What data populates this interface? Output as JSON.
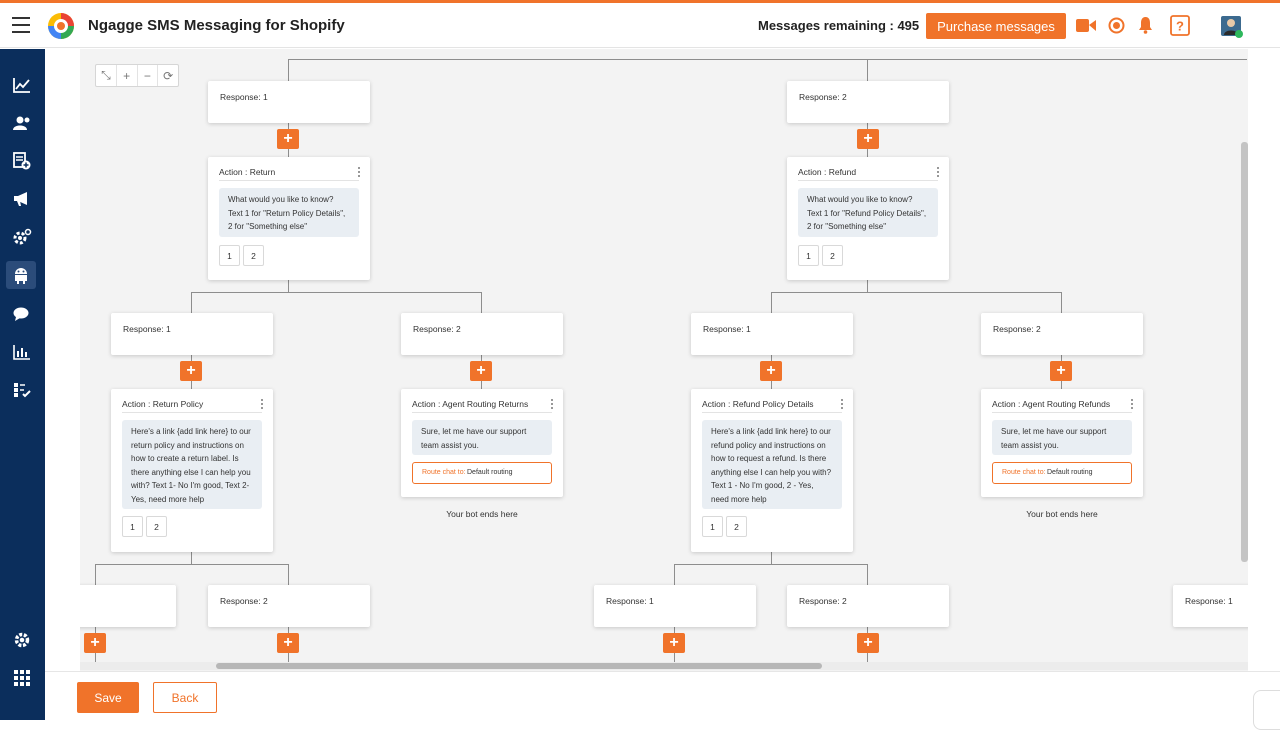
{
  "header": {
    "app_title": "Ngagge SMS Messaging for Shopify",
    "messages_remaining": "Messages remaining : 495",
    "purchase_label": "Purchase messages"
  },
  "sidebar": {
    "items": [
      "analytics-icon",
      "contacts-icon",
      "campaign-add-icon",
      "megaphone-icon",
      "automation-settings-icon",
      "bot-icon",
      "chat-icon",
      "reports-icon",
      "checklist-icon"
    ],
    "bottom": [
      "settings-icon",
      "apps-grid-icon"
    ],
    "active": "bot-icon"
  },
  "colors": {
    "accent": "#f0732a",
    "sidebar": "#0b2e5c",
    "canvas": "#f3f3f3",
    "bubble": "#e9eef3"
  },
  "flow": {
    "responses": {
      "r1": "Response: 1",
      "r2": "Response: 2",
      "r1a": "Response: 1",
      "r2a": "Response: 2",
      "r1b": "Response: 1",
      "r2b": "Response: 2",
      "r2c": "Response: 2",
      "r1d": "Response: 1",
      "r2d": "Response: 2",
      "r1e": "Response: 1"
    },
    "actions": {
      "return": {
        "title": "Action : Return",
        "text": "What would you like to know? Text 1 for \"Return Policy Details\", 2 for \"Something else\"",
        "options": [
          "1",
          "2"
        ]
      },
      "refund": {
        "title": "Action : Refund",
        "text": "What would you like to know? Text 1 for \"Refund Policy Details\", 2 for \"Something else\"",
        "options": [
          "1",
          "2"
        ]
      },
      "return_policy": {
        "title": "Action : Return Policy",
        "text": "Here's a link {add link here} to our return policy and instructions on how to create a return label. Is there anything else I can help you with? Text 1- No I'm good, Text 2- Yes, need more help",
        "options": [
          "1",
          "2"
        ]
      },
      "agent_returns": {
        "title": "Action : Agent Routing Returns",
        "text": "Sure, let me have our support team assist you.",
        "route_label": "Route chat to:",
        "route_value": "Default routing"
      },
      "refund_policy": {
        "title": "Action : Refund Policy Details",
        "text": "Here's a link {add link here} to our refund policy and instructions on how to request a refund. Is there anything else I can help you with? Text 1 - No I'm good, 2 - Yes, need more help",
        "options": [
          "1",
          "2"
        ]
      },
      "agent_refunds": {
        "title": "Action : Agent Routing Refunds",
        "text": "Sure, let me have our support team assist you.",
        "route_label": "Route chat to:",
        "route_value": "Default routing"
      }
    },
    "end_text": "Your bot ends here",
    "plus": "+"
  },
  "footer": {
    "save_label": "Save",
    "back_label": "Back"
  }
}
